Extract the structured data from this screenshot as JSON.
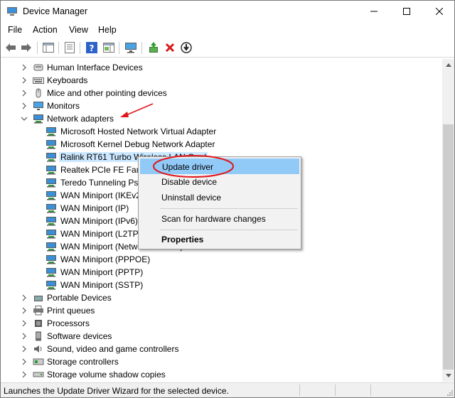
{
  "window": {
    "title": "Device Manager",
    "controls": {
      "minimize": "minimize-icon",
      "maximize": "maximize-icon",
      "close": "close-icon"
    }
  },
  "menubar": {
    "items": [
      "File",
      "Action",
      "View",
      "Help"
    ]
  },
  "toolbar": {
    "buttons": [
      "back-icon",
      "forward-icon",
      "tree-icon",
      "properties-icon",
      "help-icon",
      "action-pane-icon",
      "monitor-icon",
      "update-driver-icon",
      "uninstall-icon",
      "download-icon"
    ]
  },
  "tree": {
    "items": [
      {
        "label": "Human Interface Devices",
        "icon": "hid-icon",
        "expanded": false
      },
      {
        "label": "Keyboards",
        "icon": "keyboard-icon",
        "expanded": false
      },
      {
        "label": "Mice and other pointing devices",
        "icon": "mouse-icon",
        "expanded": false
      },
      {
        "label": "Monitors",
        "icon": "monitor-icon",
        "expanded": false
      },
      {
        "label": "Network adapters",
        "icon": "network-adapter-icon",
        "expanded": true
      },
      {
        "label": "Microsoft Hosted Network Virtual Adapter",
        "icon": "network-adapter-icon",
        "child": true
      },
      {
        "label": "Microsoft Kernel Debug Network Adapter",
        "icon": "network-adapter-icon",
        "child": true
      },
      {
        "label": "Ralink RT61 Turbo Wireless LAN Card",
        "icon": "network-adapter-icon",
        "child": true,
        "selected": true
      },
      {
        "label": "Realtek PCIe FE Family Controller",
        "icon": "network-adapter-icon",
        "child": true
      },
      {
        "label": "Teredo Tunneling Pseudo-Interface",
        "icon": "network-adapter-icon",
        "child": true
      },
      {
        "label": "WAN Miniport (IKEv2)",
        "icon": "network-adapter-icon",
        "child": true
      },
      {
        "label": "WAN Miniport (IP)",
        "icon": "network-adapter-icon",
        "child": true
      },
      {
        "label": "WAN Miniport (IPv6)",
        "icon": "network-adapter-icon",
        "child": true
      },
      {
        "label": "WAN Miniport (L2TP)",
        "icon": "network-adapter-icon",
        "child": true
      },
      {
        "label": "WAN Miniport (Network Monitor)",
        "icon": "network-adapter-icon",
        "child": true
      },
      {
        "label": "WAN Miniport (PPPOE)",
        "icon": "network-adapter-icon",
        "child": true
      },
      {
        "label": "WAN Miniport (PPTP)",
        "icon": "network-adapter-icon",
        "child": true
      },
      {
        "label": "WAN Miniport (SSTP)",
        "icon": "network-adapter-icon",
        "child": true
      },
      {
        "label": "Portable Devices",
        "icon": "portable-device-icon",
        "expanded": false
      },
      {
        "label": "Print queues",
        "icon": "printer-icon",
        "expanded": false
      },
      {
        "label": "Processors",
        "icon": "processor-icon",
        "expanded": false
      },
      {
        "label": "Software devices",
        "icon": "software-device-icon",
        "expanded": false
      },
      {
        "label": "Sound, video and game controllers",
        "icon": "sound-icon",
        "expanded": false
      },
      {
        "label": "Storage controllers",
        "icon": "storage-controller-icon",
        "expanded": false
      },
      {
        "label": "Storage volume shadow copies",
        "icon": "storage-volume-icon",
        "expanded": false
      }
    ]
  },
  "context_menu": {
    "update_driver": "Update driver",
    "disable_device": "Disable device",
    "uninstall_device": "Uninstall device",
    "scan_hardware": "Scan for hardware changes",
    "properties": "Properties"
  },
  "statusbar": {
    "text": "Launches the Update Driver Wizard for the selected device."
  },
  "colors": {
    "selection": "#cce8ff",
    "menu_highlight": "#91c9f7",
    "annotation_red": "#e0161b",
    "network_icon": "#3a8fd6"
  }
}
